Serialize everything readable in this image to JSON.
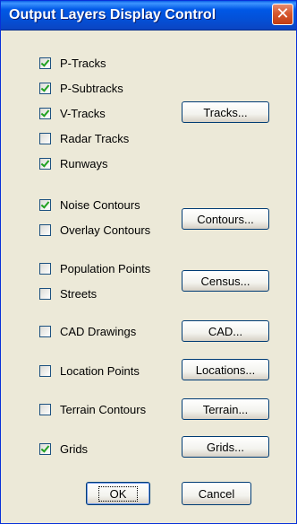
{
  "window": {
    "title": "Output Layers Display Control"
  },
  "checkboxes": [
    {
      "label": "P-Tracks",
      "checked": true
    },
    {
      "label": "P-Subtracks",
      "checked": true
    },
    {
      "label": "V-Tracks",
      "checked": true
    },
    {
      "label": "Radar Tracks",
      "checked": false
    },
    {
      "label": "Runways",
      "checked": true
    },
    {
      "label": "Noise Contours",
      "checked": true
    },
    {
      "label": "Overlay Contours",
      "checked": false
    },
    {
      "label": "Population Points",
      "checked": false
    },
    {
      "label": "Streets",
      "checked": false
    },
    {
      "label": "CAD Drawings",
      "checked": false
    },
    {
      "label": "Location Points",
      "checked": false
    },
    {
      "label": "Terrain Contours",
      "checked": false
    },
    {
      "label": "Grids",
      "checked": true
    }
  ],
  "buttons": {
    "tracks": "Tracks...",
    "contours": "Contours...",
    "census": "Census...",
    "cad": "CAD...",
    "locations": "Locations...",
    "terrain": "Terrain...",
    "grids": "Grids...",
    "ok": "OK",
    "cancel": "Cancel"
  }
}
